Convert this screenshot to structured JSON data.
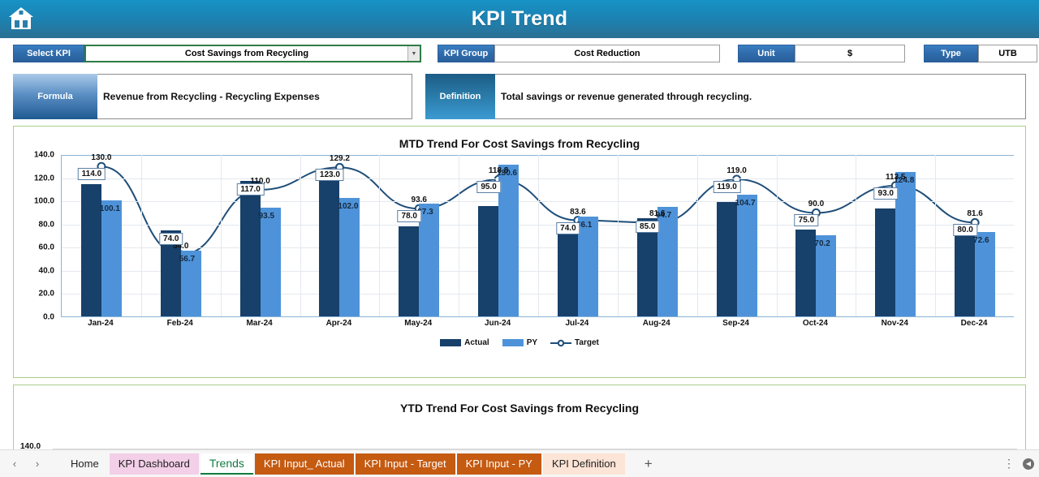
{
  "header": {
    "title": "KPI Trend",
    "home_icon": "home-icon"
  },
  "selectors": {
    "select_kpi": {
      "label": "Select KPI",
      "value": "Cost Savings from Recycling"
    },
    "kpi_group": {
      "label": "KPI Group",
      "value": "Cost Reduction"
    },
    "unit": {
      "label": "Unit",
      "value": "$"
    },
    "type": {
      "label": "Type",
      "value": "UTB"
    }
  },
  "info": {
    "formula": {
      "label": "Formula",
      "text": "Revenue from Recycling - Recycling Expenses"
    },
    "definition": {
      "label": "Definition",
      "text": "Total savings or revenue generated through recycling."
    }
  },
  "mtd": {
    "title": "MTD Trend For Cost Savings from Recycling"
  },
  "ytd": {
    "title": "YTD Trend For Cost Savings from Recycling",
    "first_tick": "140.0"
  },
  "chart_data": {
    "type": "bar",
    "title": "MTD Trend For Cost Savings from Recycling",
    "xlabel": "",
    "ylabel": "",
    "ylim": [
      0,
      140
    ],
    "ytick_step": 20,
    "grid": true,
    "legend_position": "bottom",
    "categories": [
      "Jan-24",
      "Feb-24",
      "Mar-24",
      "Apr-24",
      "May-24",
      "Jun-24",
      "Jul-24",
      "Aug-24",
      "Sep-24",
      "Oct-24",
      "Nov-24",
      "Dec-24"
    ],
    "ytick_labels": [
      "0.0",
      "20.0",
      "40.0",
      "60.0",
      "80.0",
      "100.0",
      "120.0",
      "140.0"
    ],
    "series": [
      {
        "name": "Actual",
        "type": "bar",
        "color": "#17406a",
        "values": [
          114.0,
          74.0,
          117.0,
          123.0,
          78.0,
          95.0,
          74.0,
          85.0,
          98.8,
          75.0,
          93.0,
          80.0
        ]
      },
      {
        "name": "PY",
        "type": "bar",
        "color": "#4e93d9",
        "values": [
          100.1,
          56.7,
          93.5,
          102.0,
          97.3,
          130.6,
          86.1,
          94.7,
          104.7,
          70.2,
          124.8,
          72.6
        ]
      },
      {
        "name": "Target",
        "type": "line",
        "color": "#1f4e79",
        "values": [
          130.0,
          54.0,
          110.0,
          129.2,
          93.6,
          118.8,
          83.6,
          81.6,
          119.0,
          90.0,
          113.5,
          81.6
        ]
      }
    ],
    "boxed_labels": [
      "114.0",
      "74.0",
      "117.0",
      "123.0",
      "78.0",
      "95.0",
      "74.0",
      "85.0",
      "119.0",
      "75.0",
      "93.0",
      "80.0"
    ]
  },
  "legend": [
    {
      "name": "Actual",
      "color": "#17406a",
      "marker": "bar"
    },
    {
      "name": "PY",
      "color": "#4e93d9",
      "marker": "bar"
    },
    {
      "name": "Target",
      "color": "#1f4e79",
      "marker": "line"
    }
  ],
  "tabbar": {
    "prev_icon": "chevron-left-icon",
    "next_icon": "chevron-right-icon",
    "add_label": "+",
    "kebab_icon": "kebab-menu-icon",
    "tabs": [
      {
        "label": "Home",
        "bg": "#f6f6f6",
        "active": false
      },
      {
        "label": "KPI Dashboard",
        "bg": "#f3cfe8",
        "active": false
      },
      {
        "label": "Trends",
        "bg": "#ffffff",
        "active": true
      },
      {
        "label": "KPI Input_ Actual",
        "bg": "#c55a11",
        "active": false
      },
      {
        "label": "KPI Input - Target",
        "bg": "#c55a11",
        "active": false
      },
      {
        "label": "KPI Input - PY",
        "bg": "#c55a11",
        "active": false
      },
      {
        "label": "KPI Definition",
        "bg": "#fce4d6",
        "active": false
      }
    ]
  }
}
